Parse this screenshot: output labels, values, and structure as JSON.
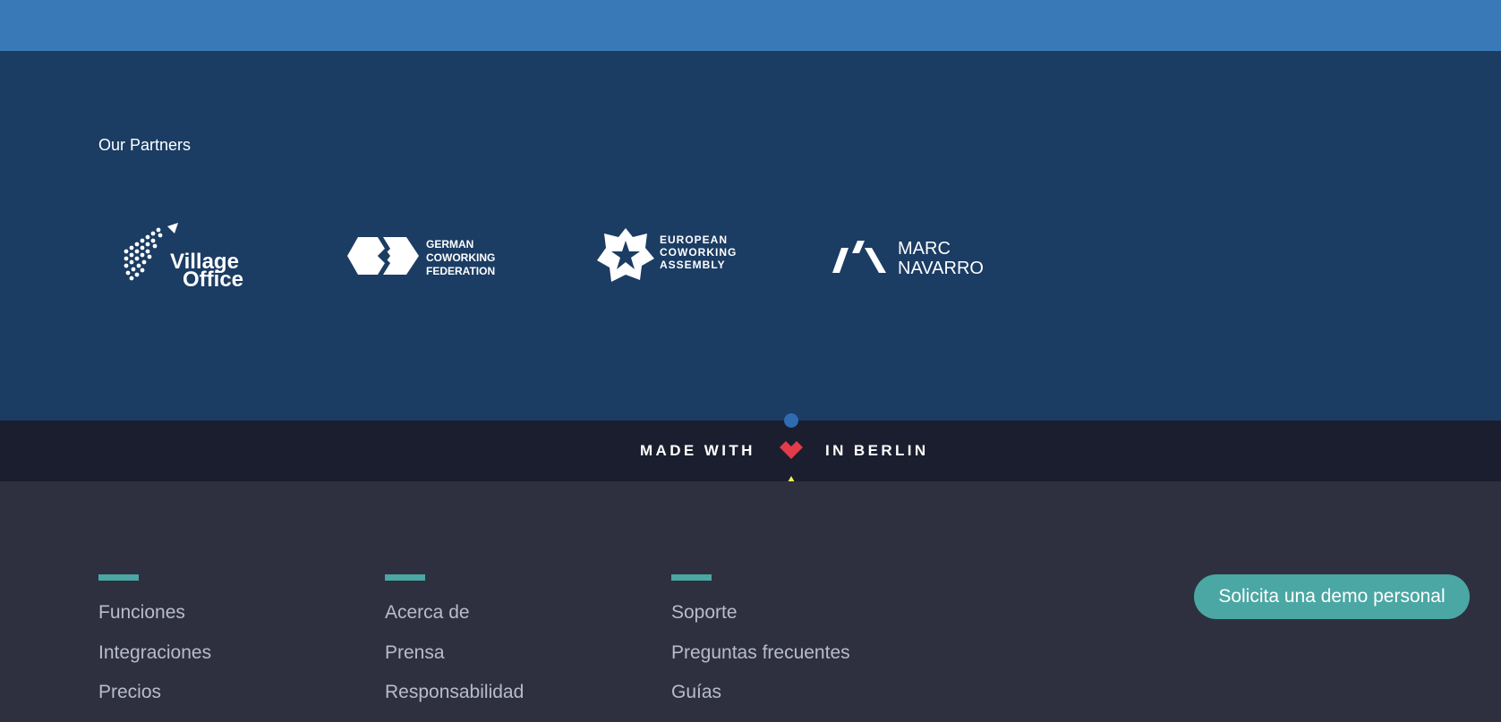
{
  "partners": {
    "title": "Our Partners",
    "logos": [
      {
        "name": "village-office",
        "lines": [
          "Village",
          "Office"
        ]
      },
      {
        "name": "german-coworking-federation",
        "lines": [
          "GERMAN",
          "COWORKING",
          "FEDERATION"
        ]
      },
      {
        "name": "european-coworking-assembly",
        "lines": [
          "EUROPEAN",
          "COWORKING",
          "ASSEMBLY"
        ]
      },
      {
        "name": "marc-navarro",
        "lines": [
          "MARC",
          "NAVARRO"
        ]
      }
    ]
  },
  "made_with": {
    "prefix": "MADE WITH",
    "suffix": "IN BERLIN",
    "icon": "heart-icon",
    "heart_color": "#e23b4a"
  },
  "footer": {
    "columns": [
      {
        "links": [
          "Funciones",
          "Integraciones",
          "Precios"
        ]
      },
      {
        "links": [
          "Acerca de",
          "Prensa",
          "Responsabilidad"
        ]
      },
      {
        "links": [
          "Soporte",
          "Preguntas frecuentes",
          "Guías"
        ]
      }
    ],
    "cta": "Solicita una demo personal"
  },
  "colors": {
    "topbar": "#3a79b8",
    "partners_bg": "#1b3c63",
    "made_bg": "#1b1e2e",
    "footer_bg": "#2e3040",
    "accent": "#4aa7a4"
  }
}
